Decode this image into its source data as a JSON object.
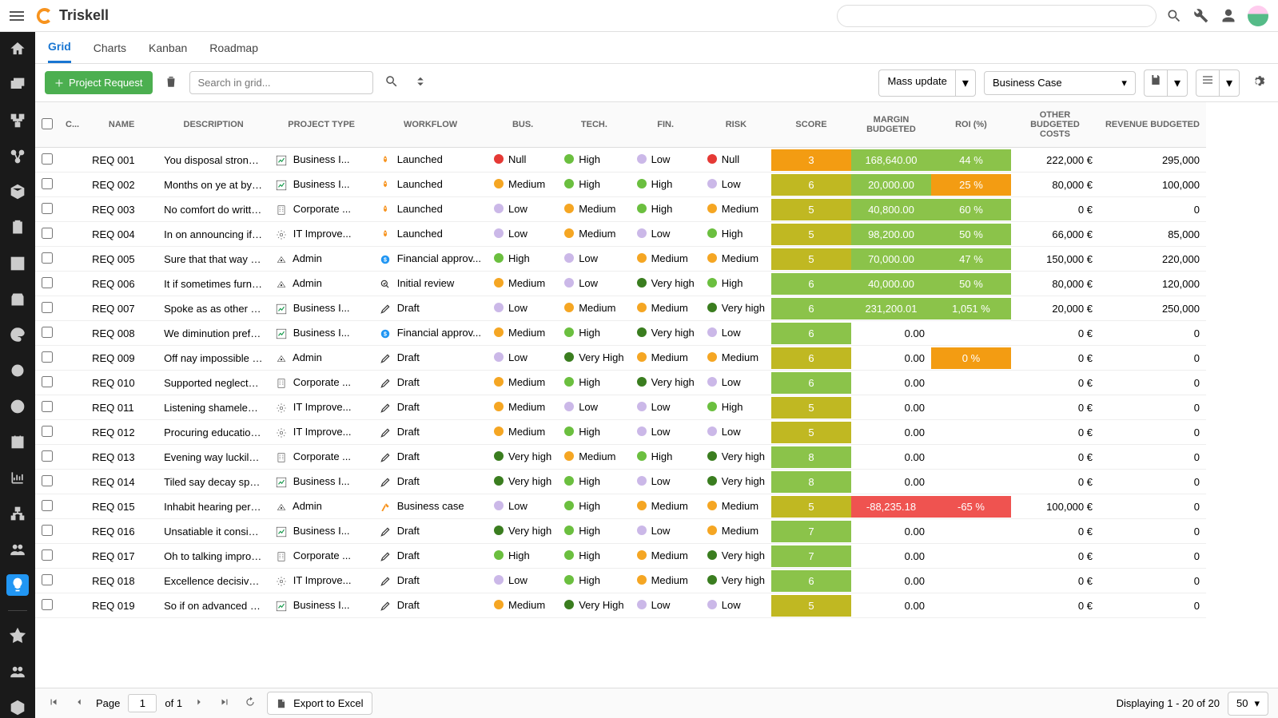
{
  "app": {
    "brand": "Triskell"
  },
  "tabs": {
    "items": [
      "Grid",
      "Charts",
      "Kanban",
      "Roadmap"
    ],
    "active": 0
  },
  "toolbar": {
    "primary_btn": "Project Request",
    "search_placeholder": "Search in grid...",
    "mass_update": "Mass update",
    "report_select": "Business Case"
  },
  "grid": {
    "columns": [
      "C...",
      "NAME",
      "DESCRIPTION",
      "PROJECT TYPE",
      "WORKFLOW",
      "BUS.",
      "TECH.",
      "FIN.",
      "RISK",
      "SCORE",
      "MARGIN BUDGETED",
      "ROI (%)",
      "OTHER BUDGETED COSTS",
      "REVENUE BUDGETED"
    ],
    "rows": [
      {
        "name": "REQ 001",
        "desc": "You disposal strongly ...",
        "ptype": "Business I...",
        "picon": "chart",
        "wf": "Launched",
        "wicon": "rocket",
        "bus": "Null",
        "bc": "#e53935",
        "tech": "High",
        "tc": "#6bbf3f",
        "fin": "Low",
        "fc": "#cbb8e8",
        "risk": "Null",
        "rc": "#e53935",
        "score": "3",
        "sc": "#f39c12",
        "margin": "168,640.00",
        "mc": "#8bc34a",
        "roi": "44 %",
        "roic": "#8bc34a",
        "other": "222,000 €",
        "rev": "295,000"
      },
      {
        "name": "REQ 002",
        "desc": "Months on ye at by es...",
        "ptype": "Business I...",
        "picon": "chart",
        "wf": "Launched",
        "wicon": "rocket",
        "bus": "Medium",
        "bc": "#f5a623",
        "tech": "High",
        "tc": "#6bbf3f",
        "fin": "High",
        "fc": "#6bbf3f",
        "risk": "Low",
        "rc": "#cbb8e8",
        "score": "6",
        "sc": "#c0b822",
        "margin": "20,000.00",
        "mc": "#8bc34a",
        "roi": "25 %",
        "roic": "#f39c12",
        "other": "80,000 €",
        "rev": "100,000"
      },
      {
        "name": "REQ 003",
        "desc": "No comfort do writte...",
        "ptype": "Corporate ...",
        "picon": "building",
        "wf": "Launched",
        "wicon": "rocket",
        "bus": "Low",
        "bc": "#cbb8e8",
        "tech": "Medium",
        "tc": "#f5a623",
        "fin": "High",
        "fc": "#6bbf3f",
        "risk": "Medium",
        "rc": "#f5a623",
        "score": "5",
        "sc": "#c0b822",
        "margin": "40,800.00",
        "mc": "#8bc34a",
        "roi": "60 %",
        "roic": "#8bc34a",
        "other": "0 €",
        "rev": "0"
      },
      {
        "name": "REQ 004",
        "desc": "In on announcing if of...",
        "ptype": "IT Improve...",
        "picon": "gear",
        "wf": "Launched",
        "wicon": "rocket",
        "bus": "Low",
        "bc": "#cbb8e8",
        "tech": "Medium",
        "tc": "#f5a623",
        "fin": "Low",
        "fc": "#cbb8e8",
        "risk": "High",
        "rc": "#6bbf3f",
        "score": "5",
        "sc": "#c0b822",
        "margin": "98,200.00",
        "mc": "#8bc34a",
        "roi": "50 %",
        "roic": "#8bc34a",
        "other": "66,000 €",
        "rev": "85,000"
      },
      {
        "name": "REQ 005",
        "desc": "Sure that that way ga...",
        "ptype": "Admin",
        "picon": "admin",
        "wf": "Financial approv...",
        "wicon": "dollar",
        "bus": "High",
        "bc": "#6bbf3f",
        "tech": "Low",
        "tc": "#cbb8e8",
        "fin": "Medium",
        "fc": "#f5a623",
        "risk": "Medium",
        "rc": "#f5a623",
        "score": "5",
        "sc": "#c0b822",
        "margin": "70,000.00",
        "mc": "#8bc34a",
        "roi": "47 %",
        "roic": "#8bc34a",
        "other": "150,000 €",
        "rev": "220,000"
      },
      {
        "name": "REQ 006",
        "desc": "It if sometimes furnis...",
        "ptype": "Admin",
        "picon": "admin",
        "wf": "Initial review",
        "wicon": "review",
        "bus": "Medium",
        "bc": "#f5a623",
        "tech": "Low",
        "tc": "#cbb8e8",
        "fin": "Very high",
        "fc": "#3a7d1f",
        "risk": "High",
        "rc": "#6bbf3f",
        "score": "6",
        "sc": "#8bc34a",
        "margin": "40,000.00",
        "mc": "#8bc34a",
        "roi": "50 %",
        "roic": "#8bc34a",
        "other": "80,000 €",
        "rev": "120,000"
      },
      {
        "name": "REQ 007",
        "desc": "Spoke as as other ag...",
        "ptype": "Business I...",
        "picon": "chart",
        "wf": "Draft",
        "wicon": "pencil",
        "bus": "Low",
        "bc": "#cbb8e8",
        "tech": "Medium",
        "tc": "#f5a623",
        "fin": "Medium",
        "fc": "#f5a623",
        "risk": "Very high",
        "rc": "#3a7d1f",
        "score": "6",
        "sc": "#8bc34a",
        "margin": "231,200.01",
        "mc": "#8bc34a",
        "roi": "1,051 %",
        "roic": "#8bc34a",
        "other": "20,000 €",
        "rev": "250,000"
      },
      {
        "name": "REQ 008",
        "desc": "We diminution prefere...",
        "ptype": "Business I...",
        "picon": "chart",
        "wf": "Financial approv...",
        "wicon": "dollar",
        "bus": "Medium",
        "bc": "#f5a623",
        "tech": "High",
        "tc": "#6bbf3f",
        "fin": "Very high",
        "fc": "#3a7d1f",
        "risk": "Low",
        "rc": "#cbb8e8",
        "score": "6",
        "sc": "#8bc34a",
        "margin": "0.00",
        "mc": "",
        "roi": "",
        "roic": "",
        "other": "0 €",
        "rev": "0"
      },
      {
        "name": "REQ 009",
        "desc": "Off nay impossible di...",
        "ptype": "Admin",
        "picon": "admin",
        "wf": "Draft",
        "wicon": "pencil",
        "bus": "Low",
        "bc": "#cbb8e8",
        "tech": "Very High",
        "tc": "#3a7d1f",
        "fin": "Medium",
        "fc": "#f5a623",
        "risk": "Medium",
        "rc": "#f5a623",
        "score": "6",
        "sc": "#c0b822",
        "margin": "0.00",
        "mc": "",
        "roi": "0 %",
        "roic": "#f39c12",
        "other": "0 €",
        "rev": "0"
      },
      {
        "name": "REQ 010",
        "desc": "Supported neglected ...",
        "ptype": "Corporate ...",
        "picon": "building",
        "wf": "Draft",
        "wicon": "pencil",
        "bus": "Medium",
        "bc": "#f5a623",
        "tech": "High",
        "tc": "#6bbf3f",
        "fin": "Very high",
        "fc": "#3a7d1f",
        "risk": "Low",
        "rc": "#cbb8e8",
        "score": "6",
        "sc": "#8bc34a",
        "margin": "0.00",
        "mc": "",
        "roi": "",
        "roic": "",
        "other": "0 €",
        "rev": "0"
      },
      {
        "name": "REQ 011",
        "desc": "Listening shameless ...",
        "ptype": "IT Improve...",
        "picon": "gear",
        "wf": "Draft",
        "wicon": "pencil",
        "bus": "Medium",
        "bc": "#f5a623",
        "tech": "Low",
        "tc": "#cbb8e8",
        "fin": "Low",
        "fc": "#cbb8e8",
        "risk": "High",
        "rc": "#6bbf3f",
        "score": "5",
        "sc": "#c0b822",
        "margin": "0.00",
        "mc": "",
        "roi": "",
        "roic": "",
        "other": "0 €",
        "rev": "0"
      },
      {
        "name": "REQ 012",
        "desc": "Procuring education ...",
        "ptype": "IT Improve...",
        "picon": "gear",
        "wf": "Draft",
        "wicon": "pencil",
        "bus": "Medium",
        "bc": "#f5a623",
        "tech": "High",
        "tc": "#6bbf3f",
        "fin": "Low",
        "fc": "#cbb8e8",
        "risk": "Low",
        "rc": "#cbb8e8",
        "score": "5",
        "sc": "#c0b822",
        "margin": "0.00",
        "mc": "",
        "roi": "",
        "roic": "",
        "other": "0 €",
        "rev": "0"
      },
      {
        "name": "REQ 013",
        "desc": "Evening way luckily s...",
        "ptype": "Corporate ...",
        "picon": "building",
        "wf": "Draft",
        "wicon": "pencil",
        "bus": "Very high",
        "bc": "#3a7d1f",
        "tech": "Medium",
        "tc": "#f5a623",
        "fin": "High",
        "fc": "#6bbf3f",
        "risk": "Very high",
        "rc": "#3a7d1f",
        "score": "8",
        "sc": "#8bc34a",
        "margin": "0.00",
        "mc": "",
        "roi": "",
        "roic": "",
        "other": "0 €",
        "rev": "0"
      },
      {
        "name": "REQ 014",
        "desc": "Tiled say decay spoil ...",
        "ptype": "Business I...",
        "picon": "chart",
        "wf": "Draft",
        "wicon": "pencil",
        "bus": "Very high",
        "bc": "#3a7d1f",
        "tech": "High",
        "tc": "#6bbf3f",
        "fin": "Low",
        "fc": "#cbb8e8",
        "risk": "Very high",
        "rc": "#3a7d1f",
        "score": "8",
        "sc": "#8bc34a",
        "margin": "0.00",
        "mc": "",
        "roi": "",
        "roic": "",
        "other": "0 €",
        "rev": "0"
      },
      {
        "name": "REQ 015",
        "desc": "Inhabit hearing perha...",
        "ptype": "Admin",
        "picon": "admin",
        "wf": "Business case",
        "wicon": "hammer",
        "bus": "Low",
        "bc": "#cbb8e8",
        "tech": "High",
        "tc": "#6bbf3f",
        "fin": "Medium",
        "fc": "#f5a623",
        "risk": "Medium",
        "rc": "#f5a623",
        "score": "5",
        "sc": "#c0b822",
        "margin": "-88,235.18",
        "mc": "#ef5350",
        "roi": "-65 %",
        "roic": "#ef5350",
        "other": "100,000 €",
        "rev": "0"
      },
      {
        "name": "REQ 016",
        "desc": "Unsatiable it consider...",
        "ptype": "Business I...",
        "picon": "chart",
        "wf": "Draft",
        "wicon": "pencil",
        "bus": "Very high",
        "bc": "#3a7d1f",
        "tech": "High",
        "tc": "#6bbf3f",
        "fin": "Low",
        "fc": "#cbb8e8",
        "risk": "Medium",
        "rc": "#f5a623",
        "score": "7",
        "sc": "#8bc34a",
        "margin": "0.00",
        "mc": "",
        "roi": "",
        "roic": "",
        "other": "0 €",
        "rev": "0"
      },
      {
        "name": "REQ 017",
        "desc": "Oh to talking improve ...",
        "ptype": "Corporate ...",
        "picon": "building",
        "wf": "Draft",
        "wicon": "pencil",
        "bus": "High",
        "bc": "#6bbf3f",
        "tech": "High",
        "tc": "#6bbf3f",
        "fin": "Medium",
        "fc": "#f5a623",
        "risk": "Very high",
        "rc": "#3a7d1f",
        "score": "7",
        "sc": "#8bc34a",
        "margin": "0.00",
        "mc": "",
        "roi": "",
        "roic": "",
        "other": "0 €",
        "rev": "0"
      },
      {
        "name": "REQ 018",
        "desc": "Excellence decisively ...",
        "ptype": "IT Improve...",
        "picon": "gear",
        "wf": "Draft",
        "wicon": "pencil",
        "bus": "Low",
        "bc": "#cbb8e8",
        "tech": "High",
        "tc": "#6bbf3f",
        "fin": "Medium",
        "fc": "#f5a623",
        "risk": "Very high",
        "rc": "#3a7d1f",
        "score": "6",
        "sc": "#8bc34a",
        "margin": "0.00",
        "mc": "",
        "roi": "",
        "roic": "",
        "other": "0 €",
        "rev": "0"
      },
      {
        "name": "REQ 019",
        "desc": "So if on advanced ad...",
        "ptype": "Business I...",
        "picon": "chart",
        "wf": "Draft",
        "wicon": "pencil",
        "bus": "Medium",
        "bc": "#f5a623",
        "tech": "Very High",
        "tc": "#3a7d1f",
        "fin": "Low",
        "fc": "#cbb8e8",
        "risk": "Low",
        "rc": "#cbb8e8",
        "score": "5",
        "sc": "#c0b822",
        "margin": "0.00",
        "mc": "",
        "roi": "",
        "roic": "",
        "other": "0 €",
        "rev": "0"
      }
    ]
  },
  "footer": {
    "page_label": "Page",
    "page_current": "1",
    "of_label": "of 1",
    "export_label": "Export to Excel",
    "display_label": "Displaying 1 - 20 of 20",
    "page_size": "50"
  }
}
